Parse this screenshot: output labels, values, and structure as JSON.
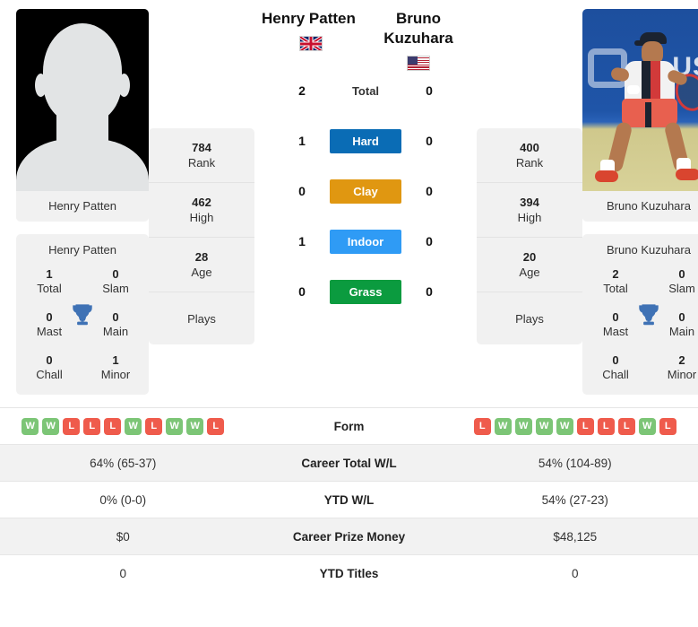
{
  "players": {
    "left": {
      "name": "Henry Patten",
      "photo_name": "Henry Patten",
      "country_flag": "uk-flag-icon",
      "photo_type": "placeholder-silhouette",
      "rank": "784",
      "rank_label": "Rank",
      "high": "462",
      "high_label": "High",
      "age": "28",
      "age_label": "Age",
      "plays_label": "Plays",
      "plays_value": "",
      "titles": {
        "total": "1",
        "total_label": "Total",
        "slam": "0",
        "slam_label": "Slam",
        "mast": "0",
        "mast_label": "Mast",
        "main": "0",
        "main_label": "Main",
        "chall": "0",
        "chall_label": "Chall",
        "minor": "1",
        "minor_label": "Minor"
      },
      "surface_wins": {
        "total": "2",
        "hard": "1",
        "clay": "0",
        "indoor": "1",
        "grass": "0"
      },
      "form": [
        "W",
        "W",
        "L",
        "L",
        "L",
        "W",
        "L",
        "W",
        "W",
        "L"
      ],
      "career_total_wl": "64% (65-37)",
      "ytd_wl": "0% (0-0)",
      "career_prize_money": "$0",
      "ytd_titles": "0"
    },
    "right": {
      "name": "Bruno Kuzuhara",
      "photo_name": "Bruno Kuzuhara",
      "country_flag": "us-flag-icon",
      "photo_type": "action-photo",
      "rank": "400",
      "rank_label": "Rank",
      "high": "394",
      "high_label": "High",
      "age": "20",
      "age_label": "Age",
      "plays_label": "Plays",
      "plays_value": "",
      "titles": {
        "total": "2",
        "total_label": "Total",
        "slam": "0",
        "slam_label": "Slam",
        "mast": "0",
        "mast_label": "Mast",
        "main": "0",
        "main_label": "Main",
        "chall": "0",
        "chall_label": "Chall",
        "minor": "2",
        "minor_label": "Minor"
      },
      "surface_wins": {
        "total": "0",
        "hard": "0",
        "clay": "0",
        "indoor": "0",
        "grass": "0"
      },
      "form": [
        "L",
        "W",
        "W",
        "W",
        "W",
        "L",
        "L",
        "L",
        "W",
        "L"
      ],
      "career_total_wl": "54% (104-89)",
      "ytd_wl": "54% (27-23)",
      "career_prize_money": "$48,125",
      "ytd_titles": "0"
    }
  },
  "surfaces": [
    {
      "key": "total",
      "label": "Total",
      "color": "#ffffff",
      "text_color": "#333333"
    },
    {
      "key": "hard",
      "label": "Hard",
      "color": "#0a6cb5",
      "text_color": "#ffffff"
    },
    {
      "key": "clay",
      "label": "Clay",
      "color": "#e09711",
      "text_color": "#ffffff"
    },
    {
      "key": "indoor",
      "label": "Indoor",
      "color": "#2f9bf5",
      "text_color": "#ffffff"
    },
    {
      "key": "grass",
      "label": "Grass",
      "color": "#0b9b3f",
      "text_color": "#ffffff"
    }
  ],
  "table": {
    "rows": [
      {
        "label": "Form",
        "key": "form",
        "type": "form"
      },
      {
        "label": "Career Total W/L",
        "key": "career_total_wl",
        "type": "text"
      },
      {
        "label": "YTD W/L",
        "key": "ytd_wl",
        "type": "text"
      },
      {
        "label": "Career Prize Money",
        "key": "career_prize_money",
        "type": "text"
      },
      {
        "label": "YTD Titles",
        "key": "ytd_titles",
        "type": "text"
      }
    ]
  },
  "colors": {
    "win_badge": "#7cc576",
    "loss_badge": "#ef5b4c",
    "card_bg": "#f1f1f1",
    "row_alt_bg": "#f2f2f2",
    "trophy": "#3f72b5"
  }
}
